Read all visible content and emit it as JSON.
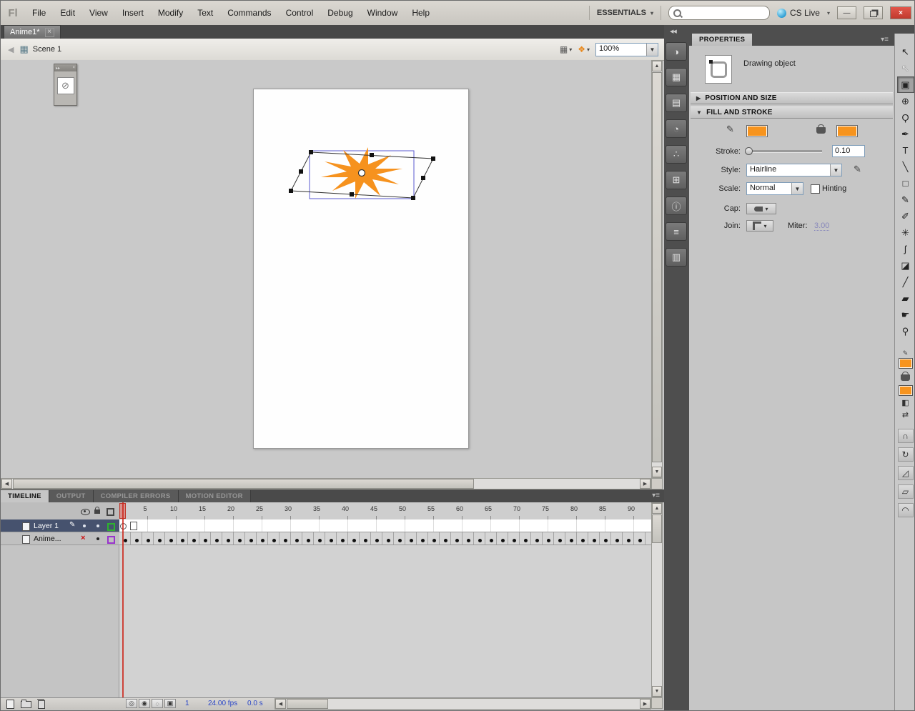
{
  "icons": {
    "close_x": "×",
    "minimize": "—",
    "dropdown": "▼",
    "dropdown_small": "▾",
    "back": "◀",
    "collapse": "◀◀",
    "expand_right": "▸▸",
    "panel_menu": "▾≡",
    "tab_close": "×",
    "up": "▲",
    "down": "▼",
    "left": "◀",
    "right": "▶",
    "section_collapsed": "▶",
    "section_expanded": "▼",
    "scene": "▦",
    "edit_scene": "▦",
    "edit_symbols": "❖",
    "no_symbol": "⊘",
    "pencil": "✎",
    "bw_colors": "◧",
    "swap_colors": "⇄"
  },
  "menubar": {
    "logo": "Fl",
    "items": [
      "File",
      "Edit",
      "View",
      "Insert",
      "Modify",
      "Text",
      "Commands",
      "Control",
      "Debug",
      "Window",
      "Help"
    ],
    "workspace": "ESSENTIALS",
    "cs_live": "CS Live",
    "search": {
      "value": "",
      "placeholder": ""
    }
  },
  "document": {
    "tab_title": "Anime1*",
    "scene": "Scene 1",
    "zoom": "100%"
  },
  "dock": {
    "icons": [
      {
        "name": "color-panel-icon",
        "glyph": "◑"
      },
      {
        "name": "swatches-panel-icon",
        "glyph": "▦"
      },
      {
        "name": "styles-panel-icon",
        "glyph": "▤"
      },
      {
        "name": "kuler-panel-icon",
        "glyph": "◔"
      },
      {
        "name": "deco-panel-icon",
        "glyph": "∴"
      },
      {
        "name": "transform-panel-icon",
        "glyph": "⊞"
      },
      {
        "name": "info-panel-icon",
        "glyph": "ⓘ"
      },
      {
        "name": "align-panel-icon",
        "glyph": "≡"
      },
      {
        "name": "library-panel-icon",
        "glyph": "▥"
      }
    ]
  },
  "properties": {
    "title": "PROPERTIES",
    "object_type": "Drawing object",
    "sections": {
      "position_size": "POSITION AND SIZE",
      "fill_stroke": "FILL AND STROKE"
    },
    "fields": {
      "stroke_label": "Stroke:",
      "stroke_value": "0.10",
      "style_label": "Style:",
      "style_value": "Hairline",
      "scale_label": "Scale:",
      "scale_value": "Normal",
      "hinting_label": "Hinting",
      "cap_label": "Cap:",
      "join_label": "Join:",
      "miter_label": "Miter:",
      "miter_value": "3.00"
    },
    "colors": {
      "stroke": "#F7941E",
      "fill": "#F7941E"
    }
  },
  "tools": {
    "main": [
      {
        "name": "selection-tool",
        "glyph": "↖"
      },
      {
        "name": "subselection-tool",
        "glyph": "↖",
        "subselect": true
      },
      {
        "name": "free-transform-tool",
        "glyph": "▣",
        "active": true
      },
      {
        "name": "3d-rotation-tool",
        "glyph": "⊕"
      },
      {
        "name": "lasso-tool",
        "glyph": "Ϙ"
      },
      {
        "name": "pen-tool",
        "glyph": "✒"
      },
      {
        "name": "text-tool",
        "glyph": "T"
      },
      {
        "name": "line-tool",
        "glyph": "╲"
      },
      {
        "name": "rectangle-tool",
        "glyph": "□"
      },
      {
        "name": "pencil-tool",
        "glyph": "✎"
      },
      {
        "name": "brush-tool",
        "glyph": "✐"
      },
      {
        "name": "deco-tool",
        "glyph": "✳"
      },
      {
        "name": "bone-tool",
        "glyph": "ʃ"
      },
      {
        "name": "paint-bucket-tool",
        "glyph": "◪"
      },
      {
        "name": "eyedropper-tool",
        "glyph": "╱"
      },
      {
        "name": "eraser-tool",
        "glyph": "▰"
      },
      {
        "name": "hand-tool",
        "glyph": "☛"
      },
      {
        "name": "zoom-tool",
        "glyph": "⚲"
      }
    ],
    "options": [
      {
        "name": "snap-to-objects-button",
        "glyph": "∩"
      },
      {
        "name": "rotate-skew-button",
        "glyph": "↻"
      },
      {
        "name": "scale-button",
        "glyph": "◿"
      },
      {
        "name": "distort-button",
        "glyph": "▱"
      },
      {
        "name": "envelope-button",
        "glyph": "◠"
      }
    ]
  },
  "timeline": {
    "tabs": [
      "TIMELINE",
      "OUTPUT",
      "COMPILER ERRORS",
      "MOTION EDITOR"
    ],
    "active_tab_index": 0,
    "ruler_numbers": [
      5,
      10,
      15,
      20,
      25,
      30,
      35,
      40,
      45,
      50,
      55,
      60,
      65,
      70,
      75,
      80,
      85,
      90
    ],
    "layers": [
      {
        "name": "Layer 1",
        "selected": true,
        "outline_color": "#2db32d"
      },
      {
        "name": "Anime...",
        "selected": false,
        "outline_color": "#9933cc"
      }
    ],
    "keyframes": {
      "count": 46,
      "spacing_px": 16
    },
    "status": {
      "current_frame": "1",
      "frame_rate": "24.00 fps",
      "elapsed_time": "0.0 s"
    }
  },
  "stage": {
    "fill": "#F6921E",
    "selection_blue": "#5b5bd0"
  }
}
